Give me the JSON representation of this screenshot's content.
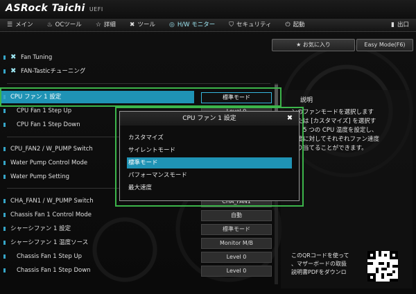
{
  "app": {
    "brand": "ASRock Taichi",
    "tagline": "UEFI"
  },
  "tabs": [
    {
      "label": "メイン",
      "icon": "menu-icon"
    },
    {
      "label": "OCツール",
      "icon": "flame-icon"
    },
    {
      "label": "詳細",
      "icon": "star-icon"
    },
    {
      "label": "ツール",
      "icon": "tools-icon"
    },
    {
      "label": "H/W モニター",
      "icon": "monitor-icon",
      "active": true
    },
    {
      "label": "セキュリティ",
      "icon": "shield-icon"
    },
    {
      "label": "起動",
      "icon": "power-icon"
    },
    {
      "label": "出口",
      "icon": "exit-icon"
    }
  ],
  "top_buttons": {
    "favorite": "お気に入り",
    "easy_mode": "Easy Mode(F6)"
  },
  "tools": [
    "Fan Tuning",
    "FAN-Tasticチューニング"
  ],
  "settings": [
    {
      "label": "CPU ファン 1 設定",
      "value": "標準モード",
      "highlight": true
    },
    {
      "label": "CPU Fan 1 Step Up",
      "value": "Level 0",
      "sub": true
    },
    {
      "label": "CPU Fan 1 Step Down",
      "value": "",
      "sub": true
    },
    {
      "label": "CPU_FAN2 / W_PUMP Switch",
      "value": ""
    },
    {
      "label": "Water Pump Control Mode",
      "value": ""
    },
    {
      "label": "Water Pump Setting",
      "value": ""
    },
    {
      "label": "CHA_FAN1 / W_PUMP Switch",
      "value": "CHA_FAN1"
    },
    {
      "label": "Chassis Fan 1 Control Mode",
      "value": "自動"
    },
    {
      "label": "シャーシファン 1 設定",
      "value": "標準モード"
    },
    {
      "label": "シャーシファン 1 温度ソース",
      "value": "Monitor M/B"
    },
    {
      "label": "Chassis Fan 1 Step Up",
      "value": "Level 0",
      "sub": true
    },
    {
      "label": "Chassis Fan 1 Step Down",
      "value": "Level 0",
      "sub": true
    }
  ],
  "description": {
    "title": "説明",
    "lines": [
      "ンのファンモードを選択します",
      "または [カスタマイズ] を選択す",
      "れ、5 つの CPU 温度を設定し、",
      "温度に対してそれぞれファン速度",
      "割り当てることができます。"
    ],
    "qr_lines": [
      "このQRコードを使って",
      "、マザーボードの取扱",
      "説明書PDFをダウンロ"
    ]
  },
  "modal": {
    "title": "CPU ファン 1 設定",
    "close": "✖",
    "options": [
      "カスタマイズ",
      "サイレントモード",
      "標準モード",
      "パフォーマンスモード",
      "最大速度"
    ],
    "selected_index": 2
  },
  "colors": {
    "accent": "#1f93b5",
    "annotation": "#3cb54a"
  }
}
